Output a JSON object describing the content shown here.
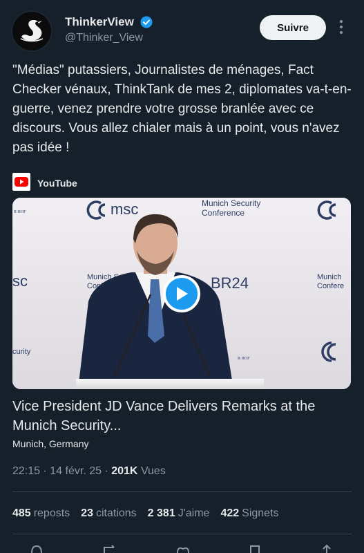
{
  "author": {
    "name": "ThinkerView",
    "handle": "@Thinker_View",
    "verified_icon": "verified-badge-icon",
    "avatar_icon": "swan-logo-icon"
  },
  "follow_label": "Suivre",
  "tweet_text": "\"Médias\" putassiers, Journalistes de ménages, Fact Checker vénaux, ThinkTank de mes 2, diplomates va-t-en-guerre,  venez prendre votre grosse branlée avec ce discours. Vous allez chialer mais à un point, vous n'avez pas idée !",
  "card": {
    "source": "YouTube",
    "title": "Vice President JD Vance Delivers Remarks at the Munich Security...",
    "subtitle": "Munich, Germany"
  },
  "video_overlay": {
    "msc_left": "msc",
    "msc_center": "msc",
    "conference_center": "Munich Security\nConference",
    "conference_left": "Munich Sec\nConfere",
    "br24": "BR24",
    "left_text_1": "sc",
    "left_text_2": "curity",
    "right_conf": "Munich\nConfere",
    "left_hof": "R HOF",
    "hof": "R HOF"
  },
  "meta": {
    "time": "22:15",
    "sep": "·",
    "date": "14 févr. 25",
    "views_count": "201K",
    "views_label": "Vues"
  },
  "stats": [
    {
      "count": "485",
      "label": "reposts"
    },
    {
      "count": "23",
      "label": "citations"
    },
    {
      "count": "2 381",
      "label": "J'aime"
    },
    {
      "count": "422",
      "label": "Signets"
    }
  ],
  "colors": {
    "background": "#15202b",
    "accent": "#1d9bf0",
    "muted": "#8b98a5",
    "youtube_red": "#ff0000"
  }
}
